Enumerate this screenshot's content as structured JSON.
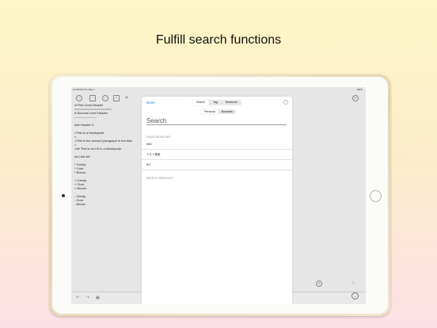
{
  "headline": "Fulfill search functions",
  "status": {
    "time": "10:38 PM  Thu May 7",
    "battery": "100%"
  },
  "toolbar": {
    "icons": [
      "back-icon",
      "share-icon",
      "info-icon",
      "list-icon",
      "preview-icon",
      "sync-icon"
    ]
  },
  "editor": {
    "lines": [
      "A First Level Header",
      "====================",
      "A Second Level Header",
      "---------------------",
      "",
      "### Header 3",
      "",
      ">This is a blockquote",
      ">",
      ">This is the second paragraph in the bloc",
      ">",
      ">## This is an H2 in a blockquote",
      "",
      "## Lists ##",
      "",
      "* Candy.",
      "* Gum.",
      "* Booze.",
      "",
      "+ Candy.",
      "+ Gum.",
      "+ Booze.",
      "",
      "- Candy.",
      "- Gum.",
      "- Booze."
    ]
  },
  "modal": {
    "done_label": "Done",
    "tabs": [
      "Search",
      "Tag",
      "Notebook"
    ],
    "active_tab": "Search",
    "scope_tabs": [
      "Personal",
      "Business"
    ],
    "active_scope": "Personal",
    "search_placeholder": "Search",
    "saved_title": "SAVED SEARCHES",
    "saved_items": [
      "ABC",
      "テスト検索",
      "BG"
    ],
    "recent_title": "RECENT SEARCHES"
  },
  "colors": {
    "accent": "#2b7fe0",
    "background_top": "#fdf6c6",
    "background_bottom": "#fde0e6"
  }
}
